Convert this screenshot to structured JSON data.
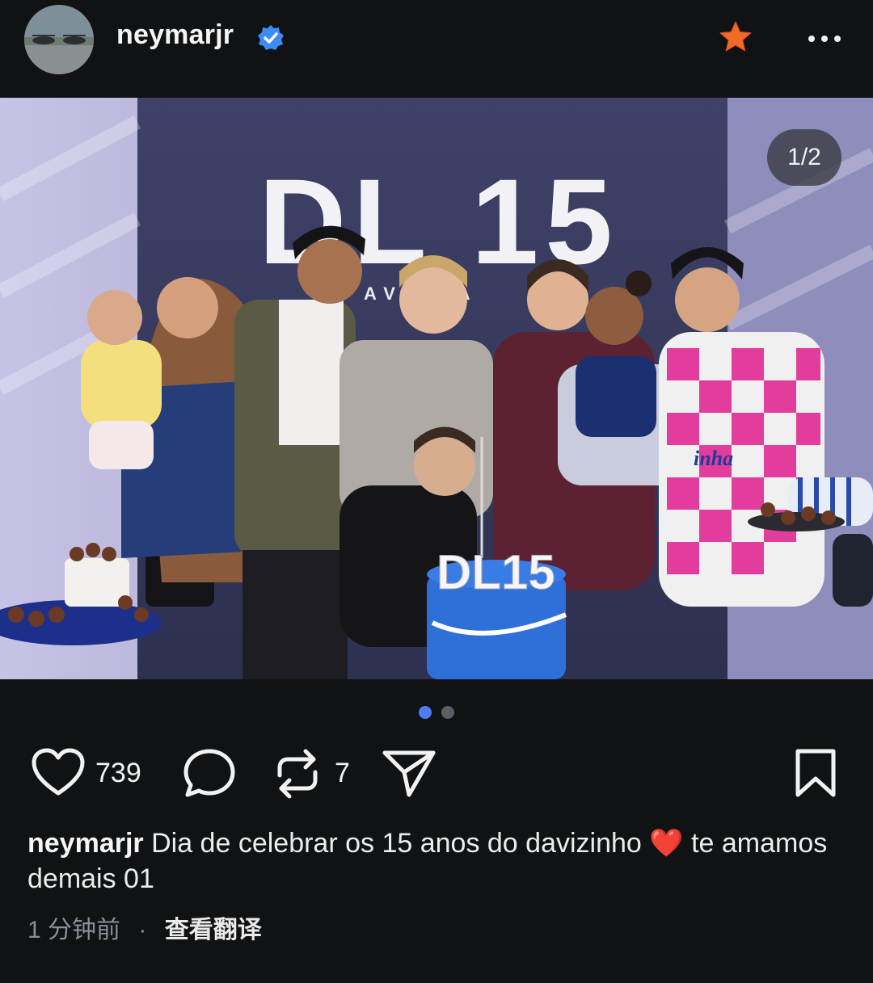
{
  "header": {
    "username": "neymarjr",
    "verified_icon": "verified-badge-icon",
    "star_icon": "star-icon",
    "more_icon": "more-options-icon"
  },
  "photo": {
    "counter": "1/2",
    "backdrop_text": "DL 15",
    "backdrop_subtext": "AVE   CA",
    "cake_text": "DL15",
    "shirt_text": "inha"
  },
  "carousel": {
    "current": 1,
    "total": 2
  },
  "actions": {
    "like_count": "739",
    "repost_count": "7",
    "icons": [
      "heart-icon",
      "comment-icon",
      "repost-icon",
      "share-icon",
      "bookmark-icon"
    ]
  },
  "caption": {
    "user": "neymarjr",
    "text_before": "Dia de celebrar os 15 anos do davizinho",
    "emoji": "❤️",
    "text_after": "te amamos demais 01"
  },
  "meta": {
    "time": "1 分钟前",
    "separator": "·",
    "translate": "查看翻译"
  },
  "colors": {
    "background": "#101214",
    "accent_blue": "#4f7cf0",
    "verified_blue": "#3b8cf5",
    "star_orange": "#f06a28"
  }
}
